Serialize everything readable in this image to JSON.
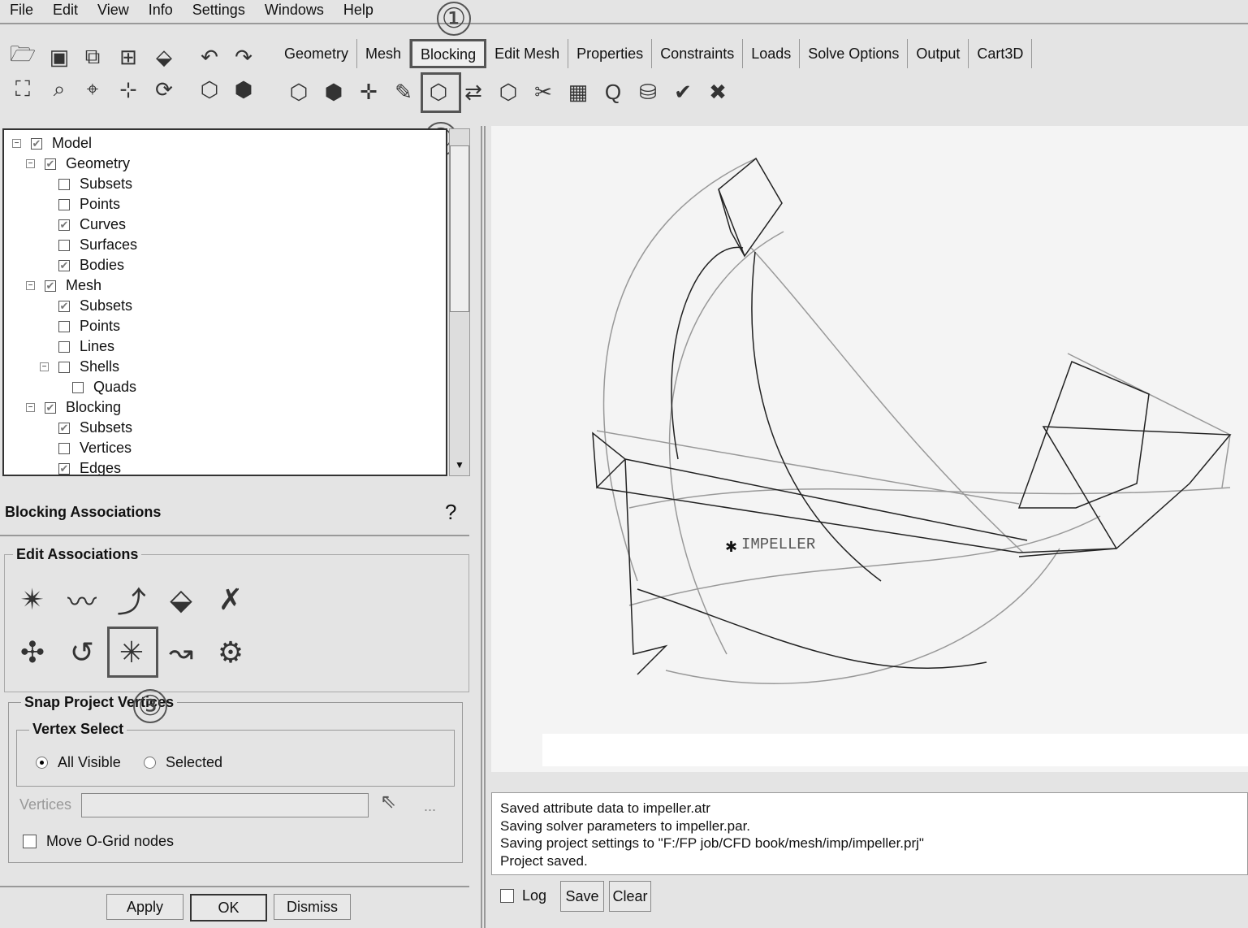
{
  "menu": [
    "File",
    "Edit",
    "View",
    "Info",
    "Settings",
    "Windows",
    "Help"
  ],
  "toolbar_left": [
    "open-icon",
    "save-icon",
    "import-geometry-icon",
    "import-mesh-icon",
    "import-blocking-icon",
    "undo-icon",
    "redo-icon",
    "fit-window-icon",
    "zoom-box-icon",
    "measure-icon",
    "lcs-icon",
    "refresh-icon",
    "wireframe-icon",
    "solid-icon"
  ],
  "tabs": [
    "Geometry",
    "Mesh",
    "Blocking",
    "Edit Mesh",
    "Properties",
    "Constraints",
    "Loads",
    "Solve Options",
    "Output",
    "Cart3D"
  ],
  "active_tab": "Blocking",
  "blocking_tools": [
    "create-block-icon",
    "split-block-icon",
    "merge-vertices-icon",
    "edit-block-icon",
    "associate-icon",
    "move-vertex-icon",
    "transform-blocks-icon",
    "edit-edge-icon",
    "pre-mesh-params-icon",
    "quality-icon",
    "extrude-faces-icon",
    "check-blocks-icon",
    "delete-block-icon"
  ],
  "markers": [
    "①",
    "②",
    "③"
  ],
  "tree": [
    {
      "label": "Model",
      "level": 0,
      "checked": true,
      "expander": true
    },
    {
      "label": "Geometry",
      "level": 1,
      "checked": true,
      "expander": true
    },
    {
      "label": "Subsets",
      "level": 2,
      "checked": false
    },
    {
      "label": "Points",
      "level": 2,
      "checked": false
    },
    {
      "label": "Curves",
      "level": 2,
      "checked": true
    },
    {
      "label": "Surfaces",
      "level": 2,
      "checked": false
    },
    {
      "label": "Bodies",
      "level": 2,
      "checked": true
    },
    {
      "label": "Mesh",
      "level": 1,
      "checked": true,
      "expander": true
    },
    {
      "label": "Subsets",
      "level": 2,
      "checked": true
    },
    {
      "label": "Points",
      "level": 2,
      "checked": false
    },
    {
      "label": "Lines",
      "level": 2,
      "checked": false
    },
    {
      "label": "Shells",
      "level": 2,
      "checked": false,
      "expander": true
    },
    {
      "label": "Quads",
      "level": 3,
      "checked": false
    },
    {
      "label": "Blocking",
      "level": 1,
      "checked": true,
      "expander": true
    },
    {
      "label": "Subsets",
      "level": 2,
      "checked": true
    },
    {
      "label": "Vertices",
      "level": 2,
      "checked": false
    },
    {
      "label": "Edges",
      "level": 2,
      "checked": true
    }
  ],
  "panel": {
    "title": "Blocking Associations",
    "help_icon": "help-icon",
    "edit_assoc": "Edit Associations",
    "assoc_tools": [
      "associate-vertex-icon",
      "associate-edge-curve-icon",
      "associate-edge-surface-icon",
      "associate-face-icon",
      "disassociate-icon",
      "set-location-icon",
      "reset-association-icon",
      "snap-project-vertices-icon",
      "update-association-icon",
      "group-curves-icon"
    ],
    "snap_title": "Snap Project Vertices",
    "vertex_select": "Vertex Select",
    "radio_all": "All Visible",
    "radio_selected": "Selected",
    "selected_radio": "All Visible",
    "vertices_label": "Vertices",
    "vertices_value": "",
    "more": "...",
    "ogrid": "Move O-Grid nodes",
    "ogrid_checked": false,
    "apply": "Apply",
    "ok": "OK",
    "dismiss": "Dismiss"
  },
  "viewport": {
    "label": "IMPELLER"
  },
  "console": {
    "lines": [
      "Saved attribute data to impeller.atr",
      "Saving solver parameters to impeller.par.",
      "Saving project settings to \"F:/FP job/CFD book/mesh/imp/impeller.prj\"",
      "Project saved."
    ],
    "log": "Log",
    "log_checked": false,
    "save": "Save",
    "clear": "Clear"
  }
}
